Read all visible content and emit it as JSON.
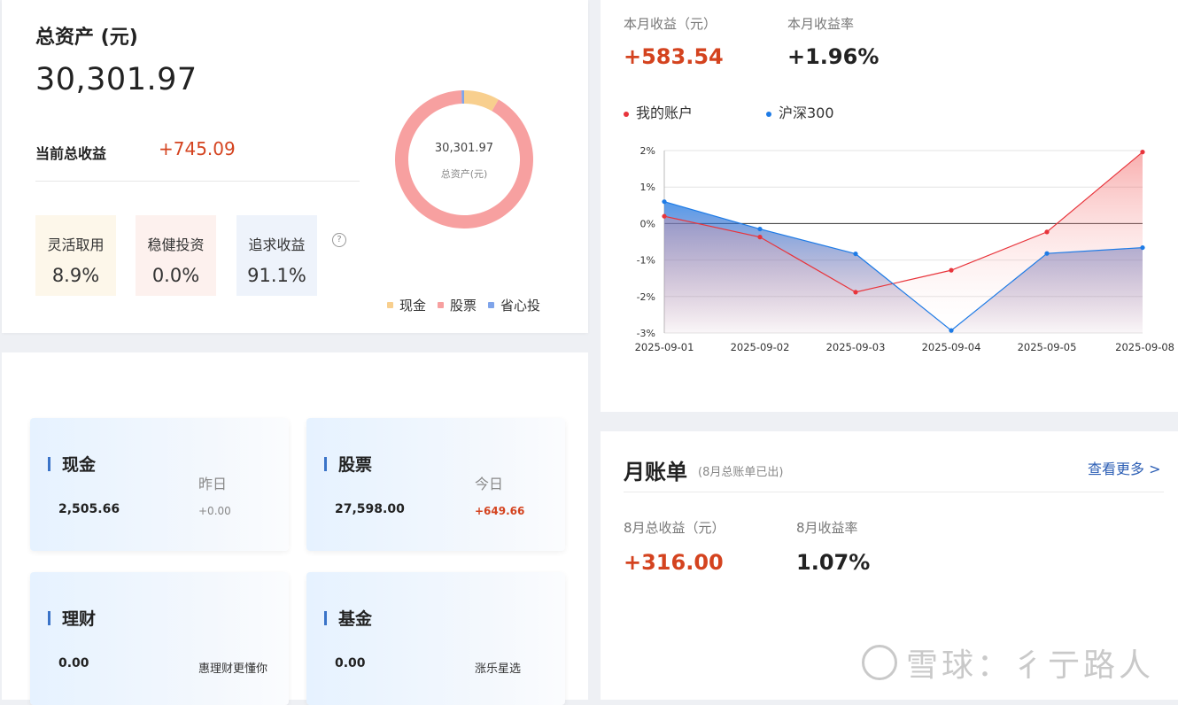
{
  "assets": {
    "title": "总资产 (元)",
    "total": "30,301.97",
    "profit_label": "当前总收益",
    "profit_value": "+745.09",
    "allocation": [
      {
        "name": "灵活取用",
        "pct": "8.9%"
      },
      {
        "name": "稳健投资",
        "pct": "0.0%"
      },
      {
        "name": "追求收益",
        "pct": "91.1%"
      }
    ],
    "help_glyph": "?",
    "donut": {
      "center_value": "30,301.97",
      "center_label": "总资产(元)",
      "slices": [
        {
          "name": "现金",
          "fraction": 0.083,
          "color": "#f8cf8e"
        },
        {
          "name": "股票",
          "fraction": 0.911,
          "color": "#f7a0a0"
        },
        {
          "name": "省心投",
          "fraction": 0.006,
          "color": "#7fa4ea"
        }
      ]
    },
    "legend": [
      {
        "name": "现金",
        "color": "#f8cf8e"
      },
      {
        "name": "股票",
        "color": "#f7a0a0"
      },
      {
        "name": "省心投",
        "color": "#7fa4ea"
      }
    ]
  },
  "positions": [
    {
      "name": "现金",
      "amount": "2,505.66",
      "tag": "昨日",
      "change": "+0.00",
      "change_color": "#888888"
    },
    {
      "name": "股票",
      "amount": "27,598.00",
      "tag": "今日",
      "change": "+649.66",
      "change_color": "#d4431f"
    },
    {
      "name": "理财",
      "amount": "0.00",
      "note": "惠理财更懂你"
    },
    {
      "name": "基金",
      "amount": "0.00",
      "note": "涨乐星选"
    }
  ],
  "month": {
    "income_label": "本月收益（元）",
    "income_value": "+583.54",
    "rate_label": "本月收益率",
    "rate_value": "+1.96%",
    "legend": [
      {
        "name": "我的账户",
        "color": "#e8343b"
      },
      {
        "name": "沪深300",
        "color": "#1e7be6"
      }
    ]
  },
  "chart_data": {
    "type": "line",
    "x": [
      "2025-09-01",
      "2025-09-02",
      "2025-09-03",
      "2025-09-04",
      "2025-09-05",
      "2025-09-08"
    ],
    "ylim": [
      -3,
      2
    ],
    "yticks": [
      "2%",
      "1%",
      "0%",
      "-1%",
      "-2%",
      "-3%"
    ],
    "yticks_values": [
      2,
      1,
      0,
      -1,
      -2,
      -3
    ],
    "series": [
      {
        "name": "我的账户",
        "color": "#e8343b",
        "values": [
          0.2,
          -0.37,
          -1.88,
          -1.28,
          -0.23,
          1.96
        ]
      },
      {
        "name": "沪深300",
        "color": "#1e7be6",
        "values": [
          0.6,
          -0.15,
          -0.83,
          -2.93,
          -0.82,
          -0.66
        ]
      }
    ],
    "grid": true,
    "legend_position": "top-left"
  },
  "bill": {
    "title": "月账单",
    "subtitle": "(8月总账单已出)",
    "more_link": "查看更多 >",
    "income_label": "8月总收益（元）",
    "income_value": "+316.00",
    "rate_label": "8月收益率",
    "rate_value": "1.07%"
  },
  "watermark": "雪球：彳亍路人"
}
